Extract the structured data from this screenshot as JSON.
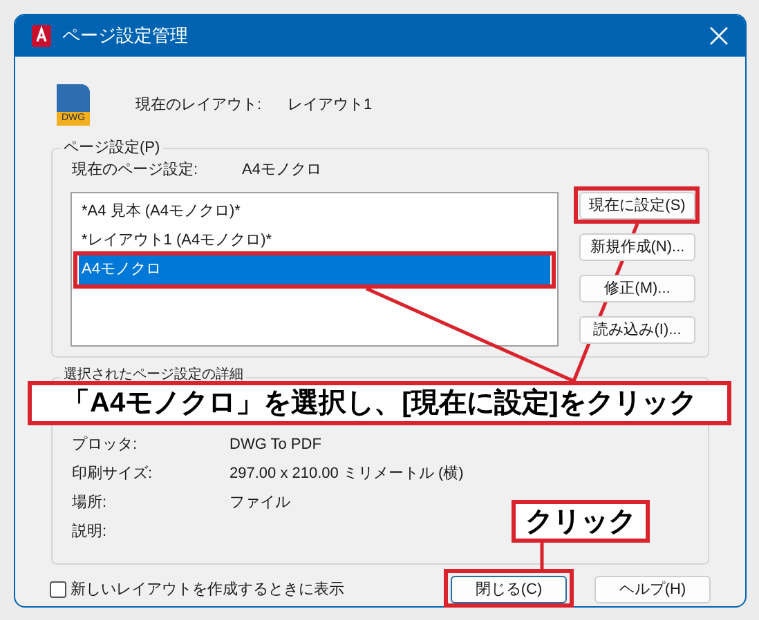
{
  "window": {
    "title": "ページ設定管理"
  },
  "file_icon_label": "DWG",
  "current_layout": {
    "label": "現在のレイアウト:",
    "value": "レイアウト1"
  },
  "page_setup": {
    "title": "ページ設定(P)",
    "current_label": "現在のページ設定:",
    "current_value": "A4モノクロ",
    "items": [
      {
        "label": "*A4 見本 (A4モノクロ)*",
        "selected": false
      },
      {
        "label": "*レイアウト1 (A4モノクロ)*",
        "selected": false
      },
      {
        "label": "A4モノクロ",
        "selected": true
      }
    ],
    "buttons": [
      "現在に設定(S)",
      "新規作成(N)...",
      "修正(M)...",
      "読み込み(I)..."
    ]
  },
  "details": {
    "title": "選択されたページ設定の詳細",
    "rows": [
      {
        "label": "プロッタ:",
        "value": "DWG To PDF"
      },
      {
        "label": "印刷サイズ:",
        "value": "297.00 x 210.00 ミリメートル (横)"
      },
      {
        "label": "場所:",
        "value": "ファイル"
      },
      {
        "label": "説明:",
        "value": ""
      }
    ]
  },
  "show_on_new_layout": {
    "label": "新しいレイアウトを作成するときに表示",
    "checked": false
  },
  "buttons": [
    {
      "label": "閉じる(C)",
      "default": true
    },
    {
      "label": "ヘルプ(H)",
      "default": false
    }
  ],
  "annotations": [
    {
      "text": "「A4モノクロ」を選択し、[現在に設定]をクリック"
    },
    {
      "text": "クリック"
    }
  ]
}
